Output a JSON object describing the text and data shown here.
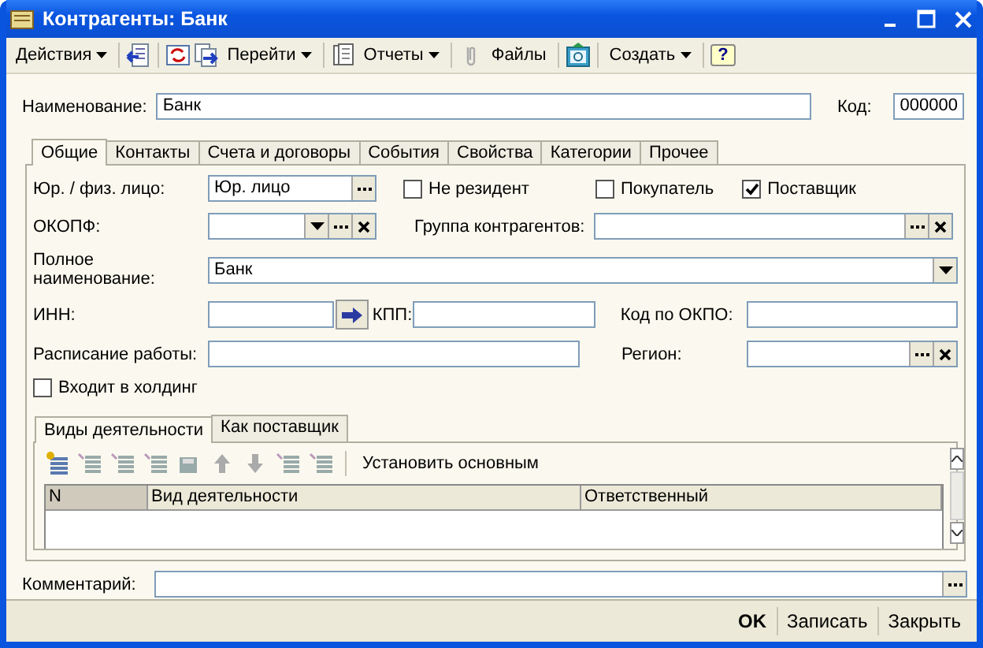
{
  "window": {
    "title": "Контрагенты: Банк"
  },
  "toolbar": [
    {
      "kind": "menu",
      "label": "Действия"
    },
    {
      "kind": "menu",
      "label": "Перейти"
    },
    {
      "kind": "menu",
      "label": "Отчеты"
    },
    {
      "kind": "button",
      "label": "Файлы"
    },
    {
      "kind": "menu",
      "label": "Создать"
    },
    {
      "kind": "help",
      "label": "?"
    }
  ],
  "name_field": {
    "label": "Наименование:",
    "value": "Банк"
  },
  "code_field": {
    "label": "Код:",
    "value": "000000"
  },
  "tabs": [
    {
      "label": "Общие",
      "selected": true
    },
    {
      "label": "Контакты",
      "selected": false
    },
    {
      "label": "Счета и договоры",
      "selected": false
    },
    {
      "label": "События",
      "selected": false
    },
    {
      "label": "Свойства",
      "selected": false
    },
    {
      "label": "Категории",
      "selected": false
    },
    {
      "label": "Прочее",
      "selected": false
    }
  ],
  "general": {
    "legal_form": {
      "label": "Юр. / физ. лицо:",
      "value": "Юр. лицо"
    },
    "checkboxes": [
      {
        "label": "Не резидент",
        "checked": false
      },
      {
        "label": "Покупатель",
        "checked": false
      },
      {
        "label": "Поставщик",
        "checked": true
      }
    ],
    "okopf": {
      "label": "ОКОПФ:"
    },
    "group": {
      "label": "Группа контрагентов:"
    },
    "full_name": {
      "label": "Полное наименование:",
      "value": "Банк"
    },
    "inn": {
      "label": "ИНН:"
    },
    "kpp": {
      "label": "КПП:"
    },
    "okpo": {
      "label": "Код по ОКПО:"
    },
    "schedule": {
      "label": "Расписание работы:"
    },
    "region": {
      "label": "Регион:"
    },
    "holding": {
      "label": "Входит в холдинг",
      "checked": false
    }
  },
  "inner_tabs": [
    {
      "label": "Виды деятельности",
      "selected": true
    },
    {
      "label": "Как поставщик",
      "selected": false
    }
  ],
  "activity_toolbar": {
    "action": "Установить основным"
  },
  "table": {
    "columns": [
      "N",
      "Вид деятельности",
      "Ответственный"
    ]
  },
  "comment": {
    "label": "Комментарий:"
  },
  "footer_buttons": [
    {
      "kind": "default",
      "label": "OK"
    },
    {
      "kind": "normal",
      "label": "Записать"
    },
    {
      "kind": "normal",
      "label": "Закрыть"
    }
  ]
}
